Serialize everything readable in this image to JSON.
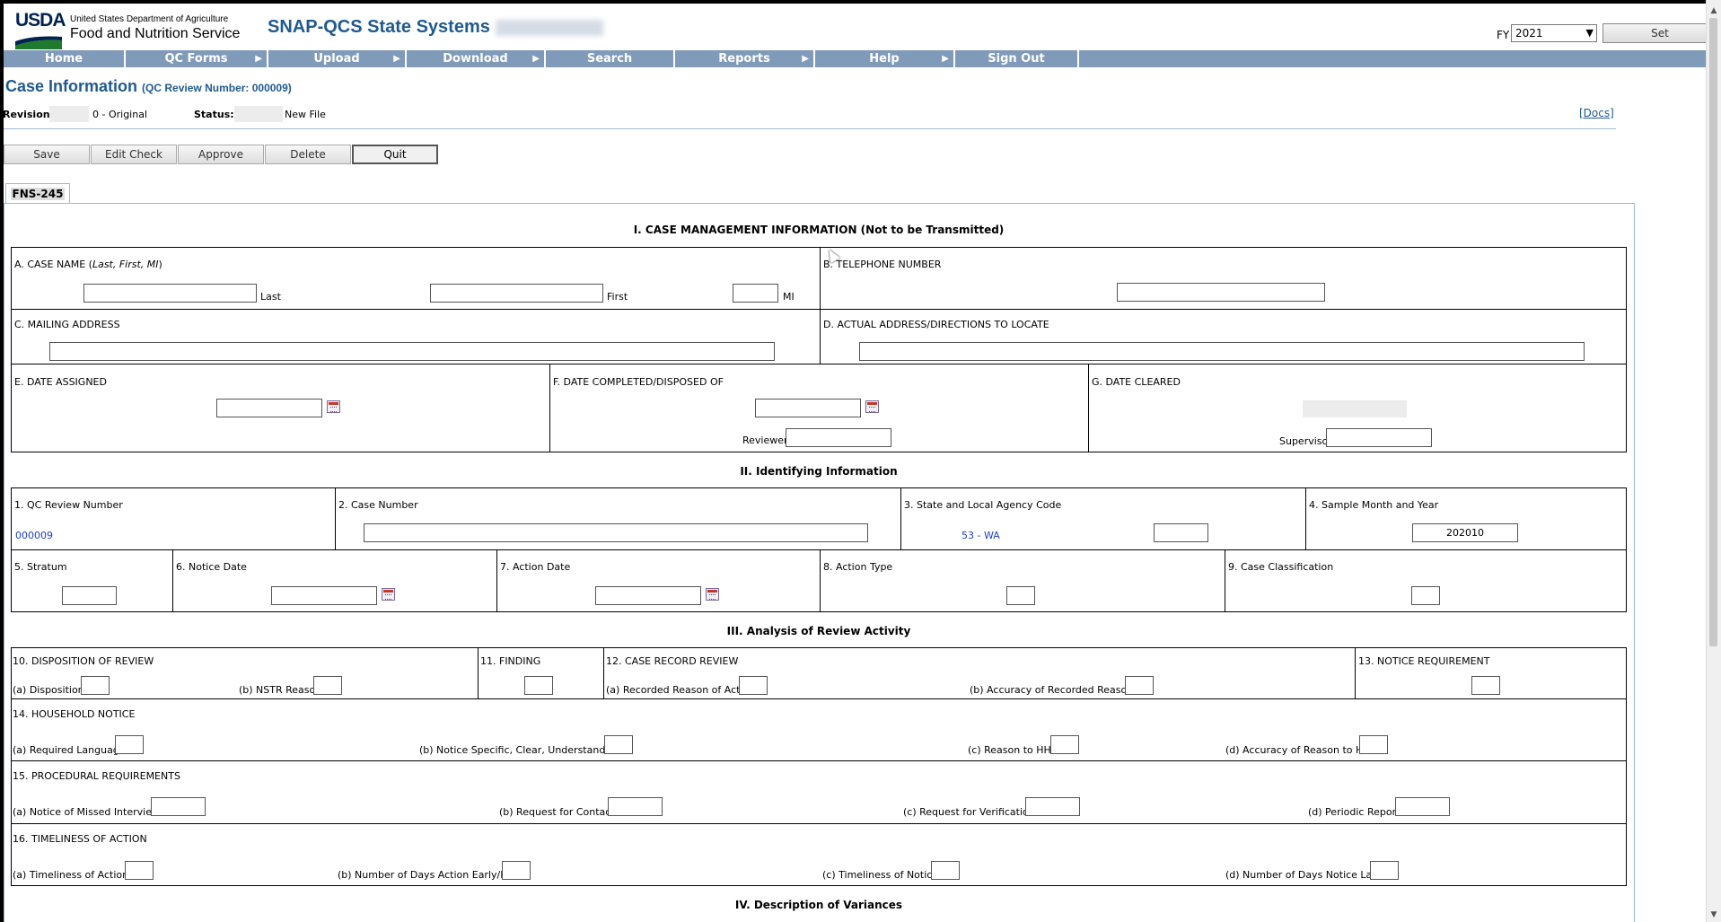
{
  "header": {
    "logo_text": "USDA",
    "department": "United States Department of Agriculture",
    "agency": "Food and Nutrition Service",
    "app_title": "SNAP-QCS State Systems",
    "fy_label": "FY",
    "fy_value": "2021",
    "set_label": "Set"
  },
  "nav": {
    "items": [
      {
        "label": "Home"
      },
      {
        "label": "QC Forms"
      },
      {
        "label": "Upload"
      },
      {
        "label": "Download"
      },
      {
        "label": "Search"
      },
      {
        "label": "Reports"
      },
      {
        "label": "Help"
      },
      {
        "label": "Sign Out"
      }
    ]
  },
  "case": {
    "title": "Case Information",
    "subtitle": "(QC Review Number: 000009)",
    "revision_label": "Revision:",
    "revision_value": "0 - Original",
    "status_label": "Status:",
    "status_value": "New File",
    "docs_label": "[Docs]"
  },
  "toolbar": {
    "save": "Save",
    "edit_check": "Edit Check",
    "approve": "Approve",
    "delete": "Delete",
    "quit": "Quit"
  },
  "tab": {
    "label": "FNS-245"
  },
  "section1": {
    "title": "I. CASE MANAGEMENT INFORMATION (Not to be Transmitted)",
    "case_name_label": "A. CASE NAME (",
    "case_name_italic": "Last, First, MI",
    "case_name_close": ")",
    "last": "Last",
    "first": "First",
    "mi": "MI",
    "telephone": "B. TELEPHONE NUMBER",
    "mailing": "C. MAILING ADDRESS",
    "actual": "D. ACTUAL ADDRESS/DIRECTIONS TO LOCATE",
    "date_assigned": "E. DATE ASSIGNED",
    "date_completed": "F. DATE COMPLETED/DISPOSED OF",
    "date_cleared": "G. DATE CLEARED",
    "reviewer": "Reviewer",
    "supervisor": "Supervisor"
  },
  "section2": {
    "title": "II. Identifying Information",
    "qc_review_number_label": "1. QC Review Number",
    "qc_review_number_value": "000009",
    "case_number_label": "2. Case Number",
    "agency_code_label": "3. State and Local Agency Code",
    "agency_code_value": "53 - WA",
    "sample_month_label": "4. Sample Month and Year",
    "sample_month_value": "202010",
    "stratum_label": "5. Stratum",
    "notice_date_label": "6. Notice Date",
    "action_date_label": "7. Action Date",
    "action_type_label": "8. Action Type",
    "case_classification_label": "9. Case Classification"
  },
  "section3": {
    "title": "III. Analysis of Review Activity",
    "disposition_title": "10. DISPOSITION OF REVIEW",
    "disposition_a": "(a) Disposition",
    "disposition_b": "(b) NSTR Reason",
    "finding_title": "11. FINDING",
    "record_title": "12. CASE RECORD REVIEW",
    "record_a": "(a) Recorded Reason of Action",
    "record_b": "(b) Accuracy of Recorded Reason",
    "notice_req_title": "13. NOTICE REQUIREMENT",
    "hh_notice_title": "14. HOUSEHOLD NOTICE",
    "hh_a": "(a) Required Language",
    "hh_b": "(b) Notice Specific, Clear, Understandable",
    "hh_c": "(c) Reason to HH",
    "hh_d": "(d) Accuracy of Reason to HH",
    "proc_title": "15. PROCEDURAL REQUIREMENTS",
    "proc_a": "(a) Notice of Missed Interview",
    "proc_b": "(b) Request for Contact",
    "proc_c": "(c) Request for Verification",
    "proc_d": "(d) Periodic Report",
    "time_title": "16. TIMELINESS OF ACTION",
    "time_a": "(a) Timeliness of Action",
    "time_b": "(b) Number of Days Action Early/Late",
    "time_c": "(c) Timeliness of Notice",
    "time_d": "(d) Number of Days Notice Late"
  },
  "section4": {
    "title": "IV. Description of Variances"
  }
}
